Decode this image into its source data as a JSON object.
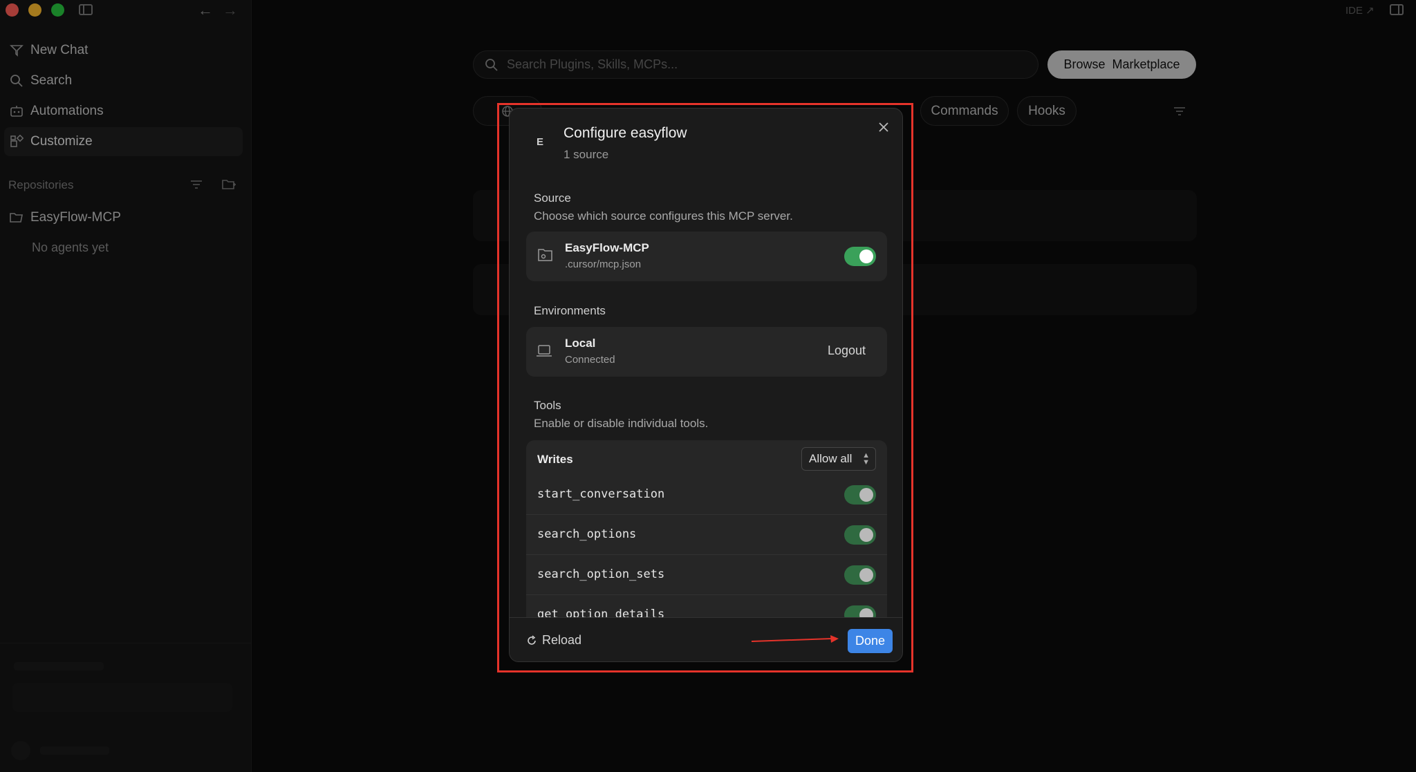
{
  "sidebar": {
    "nav": [
      {
        "label": "New Chat",
        "icon": "new-chat-icon"
      },
      {
        "label": "Search",
        "icon": "search-icon"
      },
      {
        "label": "Automations",
        "icon": "automations-icon"
      },
      {
        "label": "Customize",
        "icon": "customize-icon"
      }
    ],
    "repositories_label": "Repositories",
    "repo": {
      "name": "EasyFlow-MCP",
      "status": "No agents yet"
    }
  },
  "topbar": {
    "ide_label": "IDE ↗"
  },
  "main": {
    "search_placeholder": "Search Plugins, Skills, MCPs...",
    "browse_label": "Browse  Marketplace",
    "chips": [
      "Commands",
      "Hooks"
    ]
  },
  "modal": {
    "avatar_letter": "E",
    "title": "Configure easyflow",
    "subtitle": "1 source",
    "source": {
      "heading": "Source",
      "description": "Choose which source configures this MCP server.",
      "name": "EasyFlow-MCP",
      "path": ".cursor/mcp.json",
      "enabled": true
    },
    "environments": {
      "heading": "Environments",
      "name": "Local",
      "status": "Connected",
      "action": "Logout"
    },
    "tools": {
      "heading": "Tools",
      "description": "Enable or disable individual tools.",
      "group": "Writes",
      "group_select": "Allow all",
      "items": [
        "start_conversation",
        "search_options",
        "search_option_sets",
        "get_option_details"
      ]
    },
    "footer": {
      "reload_label": "Reload",
      "done_label": "Done"
    }
  },
  "colors": {
    "accent": "#3d85e6",
    "toggle_on": "#3aa15a",
    "highlight": "#e5332a"
  }
}
